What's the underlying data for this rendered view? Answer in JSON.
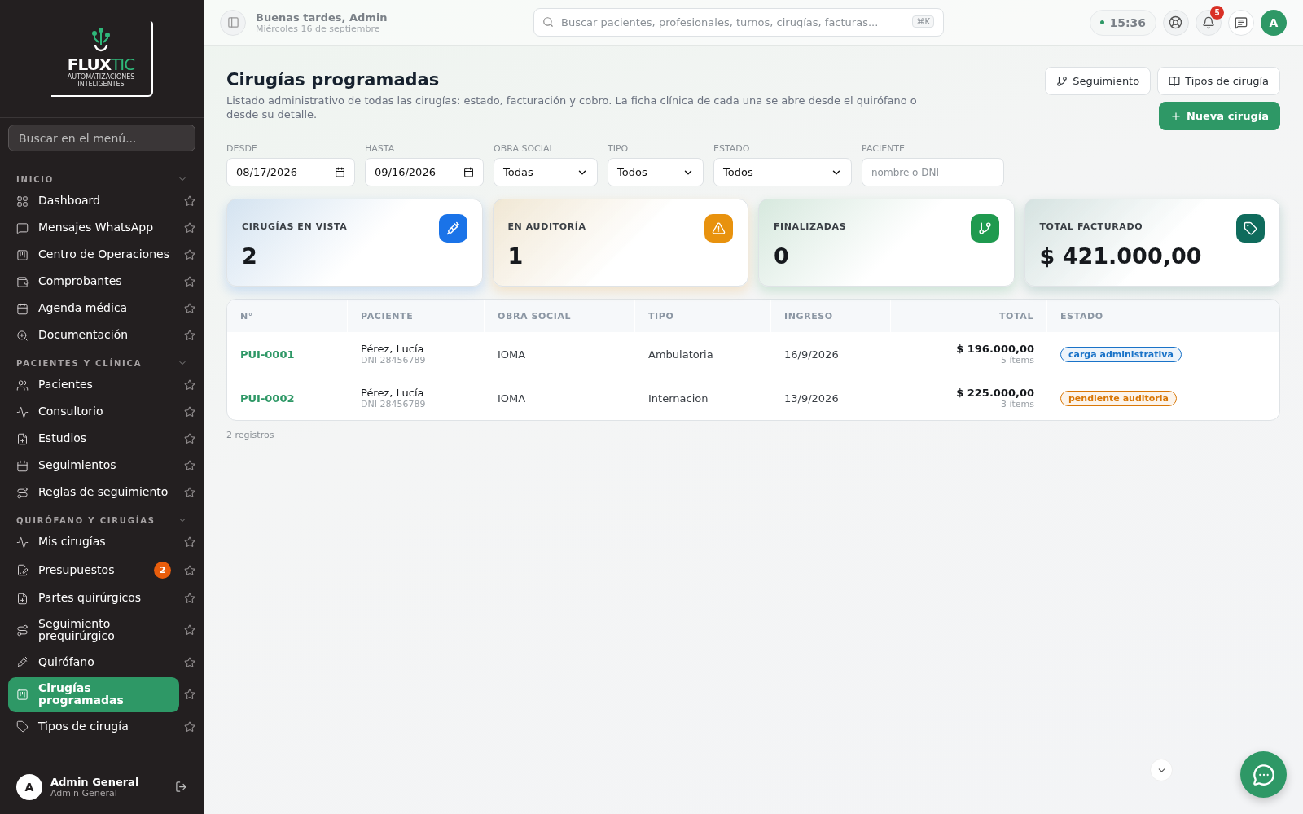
{
  "sidebar": {
    "logo": {
      "name_a": "FLUX",
      "name_b": "TIC",
      "tagline": "AUTOMATIZACIONES INTELIGENTES"
    },
    "search": {
      "placeholder": "Buscar en el menú..."
    },
    "sections": [
      {
        "title": "INICIO",
        "expanded": true,
        "items": [
          {
            "label": "Dashboard",
            "selected": false
          },
          {
            "label": "Mensajes WhatsApp",
            "selected": false
          },
          {
            "label": "Centro de Operaciones",
            "selected": false
          },
          {
            "label": "Comprobantes",
            "selected": false
          },
          {
            "label": "Agenda médica",
            "selected": false
          },
          {
            "label": "Documentación",
            "selected": false
          }
        ]
      },
      {
        "title": "PACIENTES Y CLÍNICA",
        "expanded": true,
        "items": [
          {
            "label": "Pacientes",
            "selected": false
          },
          {
            "label": "Consultorio",
            "selected": false
          },
          {
            "label": "Estudios",
            "selected": false
          },
          {
            "label": "Seguimientos",
            "selected": false
          },
          {
            "label": "Reglas de seguimiento",
            "selected": false
          }
        ]
      },
      {
        "title": "QUIRÓFANO Y CIRUGÍAS",
        "expanded": true,
        "items": [
          {
            "label": "Mis cirugías",
            "selected": false
          },
          {
            "label": "Presupuestos",
            "selected": false,
            "badge": "2"
          },
          {
            "label": "Partes quirúrgicos",
            "selected": false
          },
          {
            "label": "Seguimiento prequirúrgico",
            "selected": false
          },
          {
            "label": "Quirófano",
            "selected": false
          },
          {
            "label": "Cirugías programadas",
            "selected": true
          },
          {
            "label": "Tipos de cirugía",
            "selected": false
          }
        ]
      }
    ],
    "user": {
      "avatar": "A",
      "name": "Admin General",
      "role": "Admin General"
    }
  },
  "header": {
    "greeting": "Buenas tardes, Admin",
    "date": "Miércoles 16 de septiembre",
    "search": {
      "placeholder": "Buscar pacientes, profesionales, turnos, cirugías, facturas...",
      "shortcut": "⌘K"
    },
    "time": "15:36",
    "notifications": "5",
    "avatar": "A"
  },
  "page": {
    "title": "Cirugías programadas",
    "description": "Listado administrativo de todas las cirugías: estado, facturación y cobro. La ficha clínica de cada una se abre desde el quirófano o desde su detalle.",
    "actions": [
      {
        "label": "Seguimiento",
        "kind": "outline"
      },
      {
        "label": "Tipos de cirugía",
        "kind": "outline"
      },
      {
        "label": "Nueva cirugía",
        "kind": "primary"
      }
    ],
    "filters": [
      {
        "label": "DESDE",
        "kind": "date",
        "value": "08/17/2026"
      },
      {
        "label": "HASTA",
        "kind": "date",
        "value": "09/16/2026"
      },
      {
        "label": "OBRA SOCIAL",
        "kind": "select",
        "value": "Todas"
      },
      {
        "label": "TIPO",
        "kind": "select",
        "value": "Todos"
      },
      {
        "label": "ESTADO",
        "kind": "select",
        "value": "Todos"
      },
      {
        "label": "PACIENTE",
        "kind": "text",
        "placeholder": "nombre o DNI"
      }
    ],
    "stats": [
      {
        "label": "CIRUGÍAS EN VISTA",
        "value": "2",
        "color": "#1a73e8"
      },
      {
        "label": "EN AUDITORÍA",
        "value": "1",
        "color": "#e8920e"
      },
      {
        "label": "FINALIZADAS",
        "value": "0",
        "color": "#1f9a4f"
      },
      {
        "label": "TOTAL FACTURADO",
        "value": "$ 421.000,00",
        "color": "#0f6b5c"
      }
    ],
    "table": {
      "columns": [
        "N°",
        "PACIENTE",
        "OBRA SOCIAL",
        "TIPO",
        "INGRESO",
        "TOTAL",
        "ESTADO"
      ],
      "rows": [
        {
          "number": "PUI-0001",
          "patient": "Pérez, Lucía",
          "dni": "DNI 28456789",
          "obra_social": "IOMA",
          "tipo": "Ambulatoria",
          "ingreso": "16/9/2026",
          "total": "$ 196.000,00",
          "items": "5 ítems",
          "estado": "carga administrativa",
          "color": "#1a73c8"
        },
        {
          "number": "PUI-0002",
          "patient": "Pérez, Lucía",
          "dni": "DNI 28456789",
          "obra_social": "IOMA",
          "tipo": "Internacion",
          "ingreso": "13/9/2026",
          "total": "$ 225.000,00",
          "items": "3 ítems",
          "estado": "pendiente auditoria",
          "color": "#d97706"
        }
      ]
    },
    "count": "2 registros"
  }
}
